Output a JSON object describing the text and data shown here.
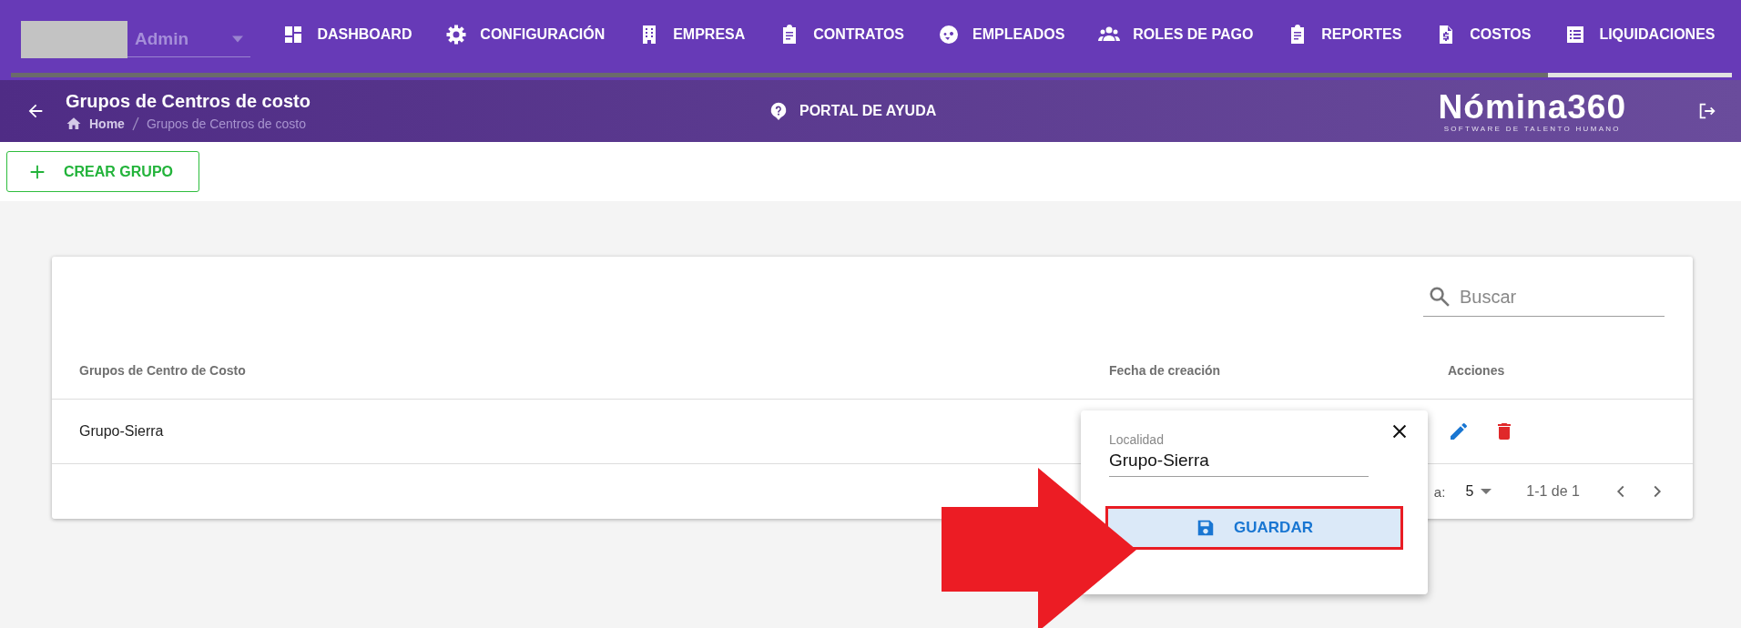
{
  "top_nav": {
    "account": {
      "role": "Admin"
    },
    "items": [
      {
        "label": "DASHBOARD",
        "selected": false
      },
      {
        "label": "CONFIGURACIÓN",
        "selected": false
      },
      {
        "label": "EMPRESA",
        "selected": false
      },
      {
        "label": "CONTRATOS",
        "selected": false
      },
      {
        "label": "EMPLEADOS",
        "selected": false
      },
      {
        "label": "ROLES DE PAGO",
        "selected": false
      },
      {
        "label": "REPORTES",
        "selected": false
      },
      {
        "label": "COSTOS",
        "selected": false
      },
      {
        "label": "LIQUIDACIONES",
        "selected": true
      }
    ]
  },
  "header": {
    "title": "Grupos de Centros de costo",
    "breadcrumb": [
      "Home",
      "Grupos de Centros de costo"
    ],
    "help_link": "PORTAL DE AYUDA",
    "logo": {
      "name": "Nómina360",
      "tagline": "SOFTWARE DE TALENTO HUMANO"
    }
  },
  "toolbar": {
    "create_button": "CREAR GRUPO"
  },
  "table": {
    "search": {
      "placeholder": "Buscar"
    },
    "columns": [
      "Grupos de Centro de Costo",
      "Fecha de creación",
      "Acciones"
    ],
    "rows": [
      {
        "name": "Grupo-Sierra"
      }
    ],
    "pagination": {
      "rows_label": "a:",
      "rows_per_page": "5",
      "range": "1-1 de 1"
    }
  },
  "edit_popup": {
    "field": {
      "label": "Localidad",
      "value": "Grupo-Sierra"
    },
    "save_button": "GUARDAR",
    "highlighted": true
  }
}
